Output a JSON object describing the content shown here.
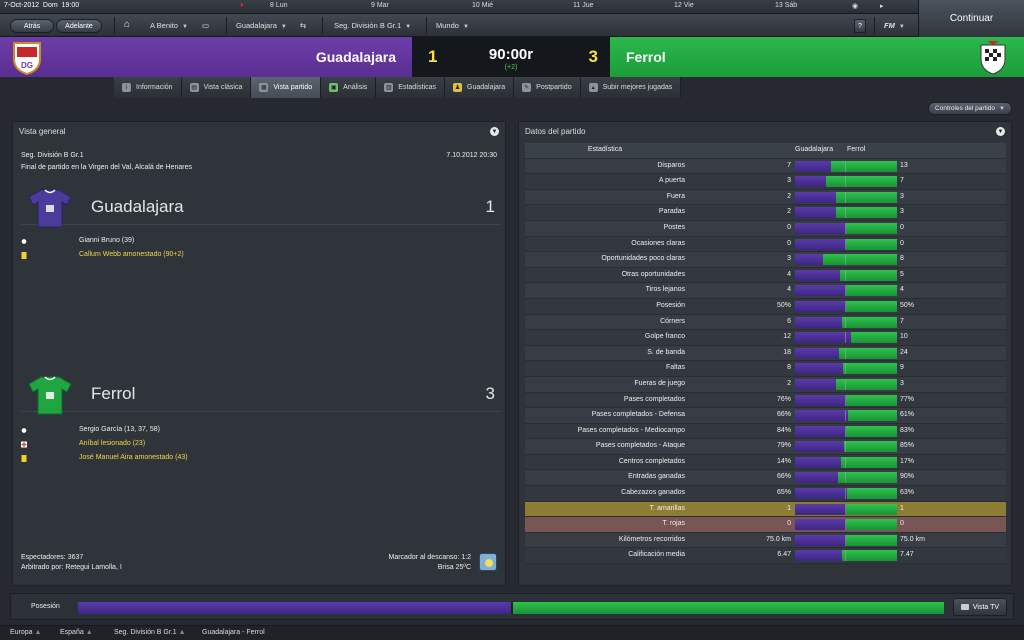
{
  "topstrip": {
    "date": "7-Oct-2012",
    "day": "Dom",
    "time": "19:00",
    "days": [
      {
        "label": "8 Lun"
      },
      {
        "label": "9 Mar"
      },
      {
        "label": "10 Mié"
      },
      {
        "label": "11 Jue"
      },
      {
        "label": "12 Vie"
      },
      {
        "label": "13 Sáb"
      }
    ],
    "continue_label": "Continuar"
  },
  "nav": {
    "back_label": "Atrás",
    "forward_label": "Adelante",
    "home_label": "A Benito",
    "club_label": "Guadalajara",
    "competition_label": "Seg. División B Gr.1",
    "world_label": "Mundo",
    "help_label": "?",
    "fm_label": "FM"
  },
  "scoreboard": {
    "home_team": "Guadalajara",
    "home_score": "1",
    "clock": "90:00r",
    "added_time": "(+2)",
    "away_score": "3",
    "away_team": "Ferrol",
    "home_color": "#6e3ea8",
    "away_color": "#2bb84c"
  },
  "tabs": [
    {
      "label": "Información",
      "icon": "info-icon"
    },
    {
      "label": "Vista clásica",
      "icon": "classic-view-icon"
    },
    {
      "label": "Vista partido",
      "icon": "match-view-icon",
      "active": true
    },
    {
      "label": "Análisis",
      "icon": "analysis-icon"
    },
    {
      "label": "Estadísticas",
      "icon": "stats-icon"
    },
    {
      "label": "Guadalajara",
      "icon": "team-icon"
    },
    {
      "label": "Postpartido",
      "icon": "post-match-icon"
    },
    {
      "label": "Subir mejores jugadas",
      "icon": "upload-icon"
    }
  ],
  "controls_label": "Controles del partido",
  "overview": {
    "title": "Vista general",
    "competition": "Seg. División B Gr.1",
    "datetime": "7.10.2012 20:30",
    "venue": "Final de partido en la Virgen del Val, Alcalá de Henares",
    "home": {
      "name": "Guadalajara",
      "goals": "1",
      "events": [
        {
          "type": "goal",
          "text": "Gianni Bruno (39)"
        },
        {
          "type": "yellow",
          "text": "Callum Webb amonestado (90+2)"
        }
      ]
    },
    "away": {
      "name": "Ferrol",
      "goals": "3",
      "events": [
        {
          "type": "goal",
          "text": "Sergio García (13, 37, 58)"
        },
        {
          "type": "injury",
          "text": "Aníbal lesionado (23)"
        },
        {
          "type": "yellow",
          "text": "José Manuel Aira amonestado (43)"
        }
      ]
    },
    "spectators": "Espectadores: 3637",
    "referee": "Arbitrado por: Retegui Lamolla, I",
    "halftime": "Marcador al descanso: 1:2",
    "weather": "Brisa 25ºC"
  },
  "stats": {
    "title": "Datos del partido",
    "header_stat": "Estadística",
    "header_home": "Guadalajara",
    "header_away": "Ferrol",
    "rows": [
      {
        "label": "Disparos",
        "home": "7",
        "away": "13",
        "hv": 7,
        "av": 13
      },
      {
        "label": "A puerta",
        "home": "3",
        "away": "7",
        "hv": 3,
        "av": 7
      },
      {
        "label": "Fuera",
        "home": "2",
        "away": "3",
        "hv": 2,
        "av": 3
      },
      {
        "label": "Paradas",
        "home": "2",
        "away": "3",
        "hv": 2,
        "av": 3
      },
      {
        "label": "Postes",
        "home": "0",
        "away": "0",
        "hv": 0,
        "av": 0
      },
      {
        "label": "Ocasiones claras",
        "home": "0",
        "away": "0",
        "hv": 0,
        "av": 0
      },
      {
        "label": "Oportunidades poco claras",
        "home": "3",
        "away": "8",
        "hv": 3,
        "av": 8
      },
      {
        "label": "Otras oportunidades",
        "home": "4",
        "away": "5",
        "hv": 4,
        "av": 5
      },
      {
        "label": "Tiros lejanos",
        "home": "4",
        "away": "4",
        "hv": 4,
        "av": 4
      },
      {
        "label": "Posesión",
        "home": "50%",
        "away": "50%",
        "hv": 50,
        "av": 50
      },
      {
        "label": "Córners",
        "home": "6",
        "away": "7",
        "hv": 6,
        "av": 7
      },
      {
        "label": "Golpe franco",
        "home": "12",
        "away": "10",
        "hv": 12,
        "av": 10
      },
      {
        "label": "S. de banda",
        "home": "18",
        "away": "24",
        "hv": 18,
        "av": 24
      },
      {
        "label": "Faltas",
        "home": "8",
        "away": "9",
        "hv": 8,
        "av": 9
      },
      {
        "label": "Fueras de juego",
        "home": "2",
        "away": "3",
        "hv": 2,
        "av": 3
      },
      {
        "label": "Pases completados",
        "home": "76%",
        "away": "77%",
        "hv": 76,
        "av": 77
      },
      {
        "label": "Pases completados - Defensa",
        "home": "66%",
        "away": "61%",
        "hv": 66,
        "av": 61
      },
      {
        "label": "Pases completados - Mediocampo",
        "home": "84%",
        "away": "83%",
        "hv": 84,
        "av": 83
      },
      {
        "label": "Pases completados - Ataque",
        "home": "79%",
        "away": "85%",
        "hv": 79,
        "av": 85
      },
      {
        "label": "Centros completados",
        "home": "14%",
        "away": "17%",
        "hv": 14,
        "av": 17
      },
      {
        "label": "Entradas ganadas",
        "home": "66%",
        "away": "90%",
        "hv": 66,
        "av": 90
      },
      {
        "label": "Cabezazos ganados",
        "home": "65%",
        "away": "63%",
        "hv": 65,
        "av": 63
      },
      {
        "label": "T. amarillas",
        "home": "1",
        "away": "1",
        "hv": 1,
        "av": 1,
        "highlight": "yellow"
      },
      {
        "label": "T. rojas",
        "home": "0",
        "away": "0",
        "hv": 0,
        "av": 0,
        "highlight": "red"
      },
      {
        "label": "Kilómetros recorridos",
        "home": "75.0 km",
        "away": "75.0 km",
        "hv": 75,
        "av": 75
      },
      {
        "label": "Calificación media",
        "home": "6.47",
        "away": "7.47",
        "hv": 6.47,
        "av": 7.47
      }
    ]
  },
  "possession": {
    "label": "Posesión",
    "home_share": 0.5,
    "tv_label": "Vista TV"
  },
  "footer": {
    "crumbs": [
      "Europa",
      "España",
      "Seg. División B Gr.1",
      "Guadalajara - Ferrol"
    ]
  }
}
